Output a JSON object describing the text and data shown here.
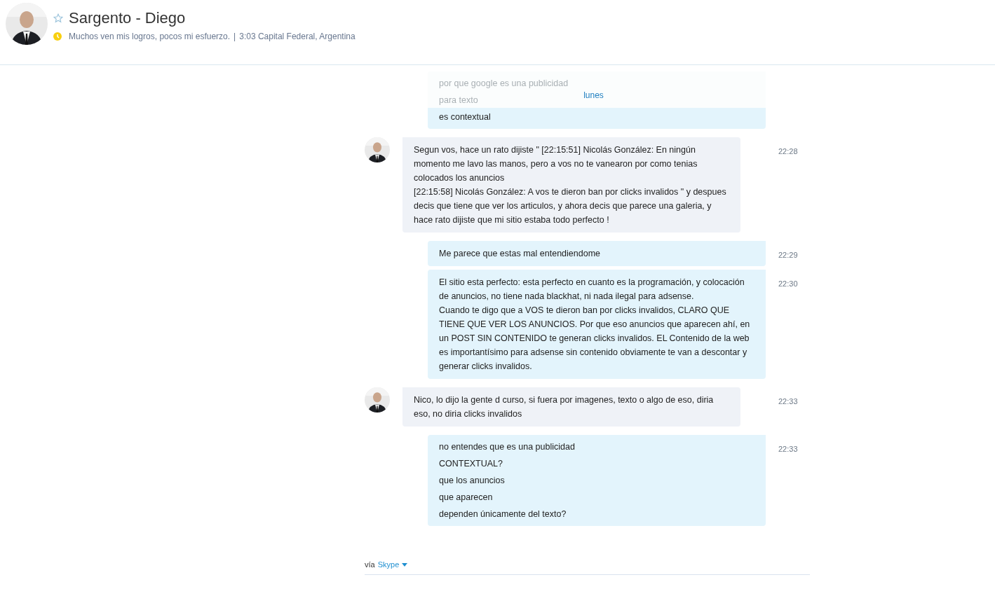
{
  "contact": {
    "name": "Sargento - Diego",
    "favorite": false,
    "mood": "Muchos ven mis logros, pocos mi esfuerzo.",
    "separator": "|",
    "local_info": "3:03 Capital Federal, Argentina"
  },
  "day_label": "lunes",
  "messages": [
    {
      "kind": "outgoing",
      "grouped": true,
      "lines": [
        {
          "text": "por que google es una publicidad",
          "faded": true
        },
        {
          "text": "para texto",
          "faded": true
        },
        {
          "text": "es contextual",
          "faded": false
        }
      ]
    },
    {
      "kind": "incoming",
      "grouped": false,
      "time": "22:28",
      "lines": [
        {
          "text": "Segun vos, hace un rato dijiste \" [22:15:51] Nicolás González: En ningún momento me lavo las manos, pero a vos no te vanearon por como tenias colocados los anuncios",
          "faded": false
        },
        {
          "text": "[22:15:58] Nicolás González: A vos te dieron ban por clicks invalidos \" y despues decis que tiene que ver los articulos, y ahora decis que parece una galeria, y hace rato dijiste que mi sitio estaba todo perfecto !",
          "faded": false
        }
      ]
    },
    {
      "kind": "outgoing",
      "grouped": false,
      "time": "22:29",
      "lines": [
        {
          "text": "Me parece que estas mal entendiendome",
          "faded": false
        }
      ]
    },
    {
      "kind": "outgoing",
      "grouped": false,
      "time": "22:30",
      "lines": [
        {
          "text": "El sitio esta perfecto: esta perfecto en cuanto es la programación, y colocación de anuncios, no tiene nada blackhat, ni nada ilegal para adsense.",
          "faded": false
        },
        {
          "text": "Cuando te digo que a VOS te dieron ban por clicks invalidos, CLARO QUE TIENE QUE VER LOS ANUNCIOS. Por que eso anuncios que aparecen ahí, en un POST SIN CONTENIDO te generan clicks invalidos. EL Contenido de la web es importantísimo para adsense sin contenido obviamente te van a descontar y generar clicks invalidos.",
          "faded": false
        }
      ]
    },
    {
      "kind": "incoming",
      "grouped": false,
      "time": "22:33",
      "lines": [
        {
          "text": "Nico, lo dijo la gente d curso, si fuera por imagenes, texto o algo de eso, diria eso, no diria clicks invalidos",
          "faded": false
        }
      ]
    },
    {
      "kind": "outgoing",
      "grouped": true,
      "time": "22:33",
      "lines": [
        {
          "text": "no entendes que es una publicidad",
          "faded": false
        },
        {
          "text": "CONTEXTUAL?",
          "faded": false
        },
        {
          "text": "que los anuncios",
          "faded": false
        },
        {
          "text": "que aparecen",
          "faded": false
        },
        {
          "text": "dependen únicamente del texto?",
          "faded": false
        }
      ]
    }
  ],
  "footer": {
    "via": "vía",
    "service": "Skype"
  }
}
